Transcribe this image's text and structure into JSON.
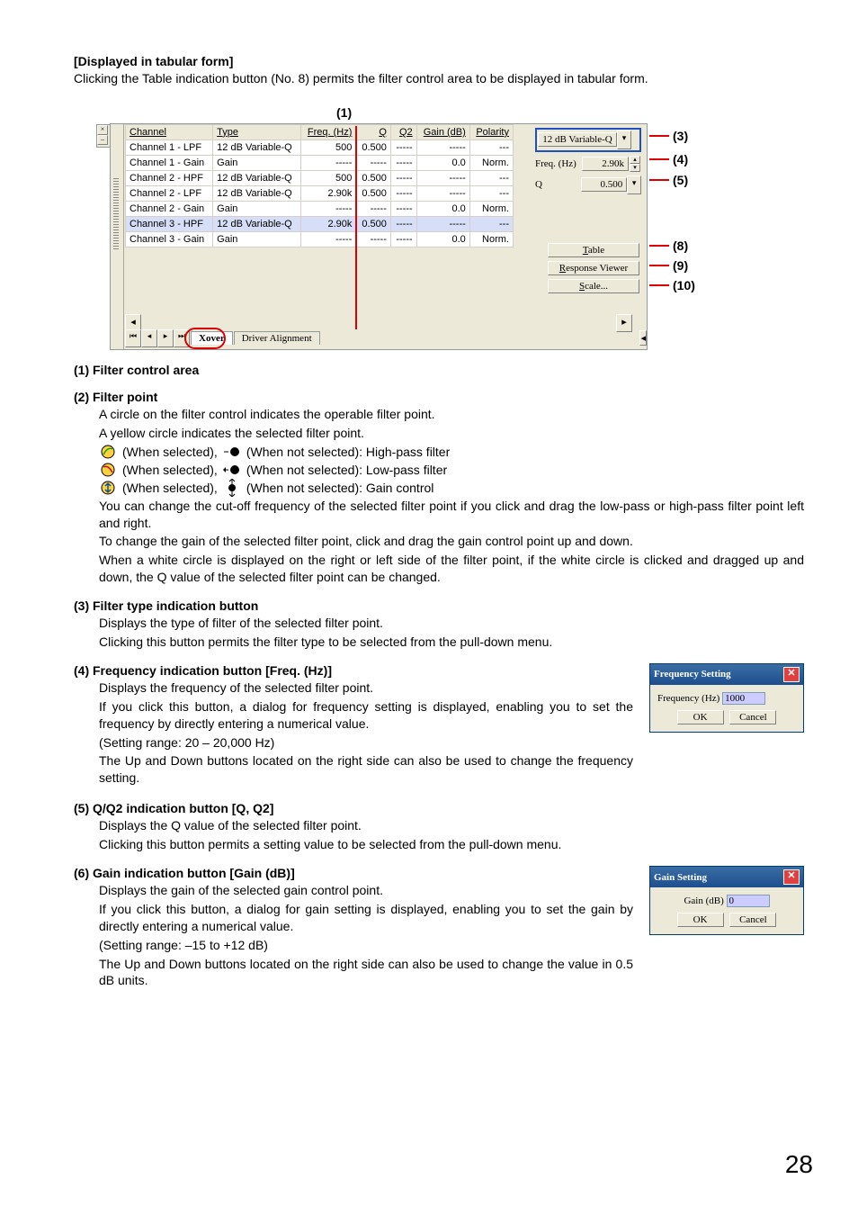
{
  "header": {
    "title": "[Displayed in tabular form]",
    "desc": "Clicking the Table indication button (No. 8) permits the filter control area to be displayed in tabular form."
  },
  "label1": "(1)",
  "table": {
    "headers": {
      "ch": "Channel",
      "type": "Type",
      "freq": "Freq. (Hz)",
      "q": "Q",
      "q2": "Q2",
      "gain": "Gain (dB)",
      "pol": "Polarity"
    },
    "rows": [
      {
        "ch": "Channel 1 - LPF",
        "type": "12 dB Variable-Q",
        "freq": "500",
        "q": "0.500",
        "q2": "-----",
        "gain": "-----",
        "pol": "---"
      },
      {
        "ch": "Channel 1 - Gain",
        "type": "Gain",
        "freq": "-----",
        "q": "-----",
        "q2": "-----",
        "gain": "0.0",
        "pol": "Norm."
      },
      {
        "ch": "Channel 2 - HPF",
        "type": "12 dB Variable-Q",
        "freq": "500",
        "q": "0.500",
        "q2": "-----",
        "gain": "-----",
        "pol": "---"
      },
      {
        "ch": "Channel 2 - LPF",
        "type": "12 dB Variable-Q",
        "freq": "2.90k",
        "q": "0.500",
        "q2": "-----",
        "gain": "-----",
        "pol": "---"
      },
      {
        "ch": "Channel 2 - Gain",
        "type": "Gain",
        "freq": "-----",
        "q": "-----",
        "q2": "-----",
        "gain": "0.0",
        "pol": "Norm."
      },
      {
        "ch": "Channel 3 - HPF",
        "type": "12 dB Variable-Q",
        "freq": "2.90k",
        "q": "0.500",
        "q2": "-----",
        "gain": "-----",
        "pol": "---",
        "sel": true
      },
      {
        "ch": "Channel 3 - Gain",
        "type": "Gain",
        "freq": "-----",
        "q": "-----",
        "q2": "-----",
        "gain": "0.0",
        "pol": "Norm."
      }
    ]
  },
  "side": {
    "filter_type": "12 dB Variable-Q",
    "freq_lbl": "Freq. (Hz)",
    "freq_val": "2.90k",
    "q_lbl": "Q",
    "q_val": "0.500",
    "btn_table": "Table",
    "btn_table_u": "T",
    "btn_resp": "Response Viewer",
    "btn_resp_u": "R",
    "btn_scale": "Scale...",
    "btn_scale_u": "S"
  },
  "tabs": {
    "xover": "Xover",
    "driver": "Driver Alignment"
  },
  "callouts": {
    "c3": "(3)",
    "c4": "(4)",
    "c5": "(5)",
    "c8": "(8)",
    "c9": "(9)",
    "c10": "(10)"
  },
  "s1": {
    "h": "(1) Filter control area"
  },
  "s2": {
    "h": "(2) Filter point",
    "p1": "A circle on the filter control indicates the operable filter point.",
    "p2": "A yellow circle indicates the selected filter point.",
    "l1a": "(When selected),",
    "l1b": "(When not selected): High-pass filter",
    "l2a": "(When selected),",
    "l2b": "(When not selected): Low-pass filter",
    "l3a": "(When selected),",
    "l3b": "(When not selected): Gain control",
    "p3": "You can change the cut-off frequency of the selected filter point if you click and drag the low-pass or high-pass filter point left and right.",
    "p4": "To change the gain of the selected filter point, click and drag the gain control point up and down.",
    "p5": "When a white circle is displayed on the right or left side of the filter point, if the white circle is clicked and dragged up and down, the Q value of the selected filter point can be changed."
  },
  "s3": {
    "h": "(3) Filter type indication button",
    "p1": "Displays the type of filter of the selected filter point.",
    "p2": "Clicking this button permits the filter type to be selected from the pull-down menu."
  },
  "s4": {
    "h": "(4) Frequency indication button [Freq. (Hz)]",
    "p1": "Displays the frequency of the selected filter point.",
    "p2": "If you click this button, a dialog for frequency setting is displayed, enabling you to set the frequency by directly entering a numerical value.",
    "p3": "(Setting range: 20 – 20,000 Hz)",
    "p4": "The Up and Down buttons located on the right side can also be used to change the frequency setting."
  },
  "freq_dialog": {
    "title": "Frequency Setting",
    "lbl": "Frequency (Hz)",
    "val": "1000",
    "ok": "OK",
    "cancel": "Cancel"
  },
  "s5": {
    "h": "(5) Q/Q2 indication button [Q, Q2]",
    "p1": "Displays the Q value of the selected filter point.",
    "p2": "Clicking this button permits a setting value to be selected from the pull-down menu."
  },
  "s6": {
    "h": "(6) Gain indication button [Gain (dB)]",
    "p1": "Displays the gain of the selected gain control point.",
    "p2": "If you click this button, a dialog for gain setting is displayed, enabling you to set the gain by directly entering a numerical value.",
    "p3": "(Setting range: –15 to +12 dB)",
    "p4": "The Up and Down buttons located on the right side can also be used to change the value in 0.5 dB units."
  },
  "gain_dialog": {
    "title": "Gain Setting",
    "lbl": "Gain (dB)",
    "val": "0",
    "ok": "OK",
    "cancel": "Cancel"
  },
  "page_number": "28"
}
